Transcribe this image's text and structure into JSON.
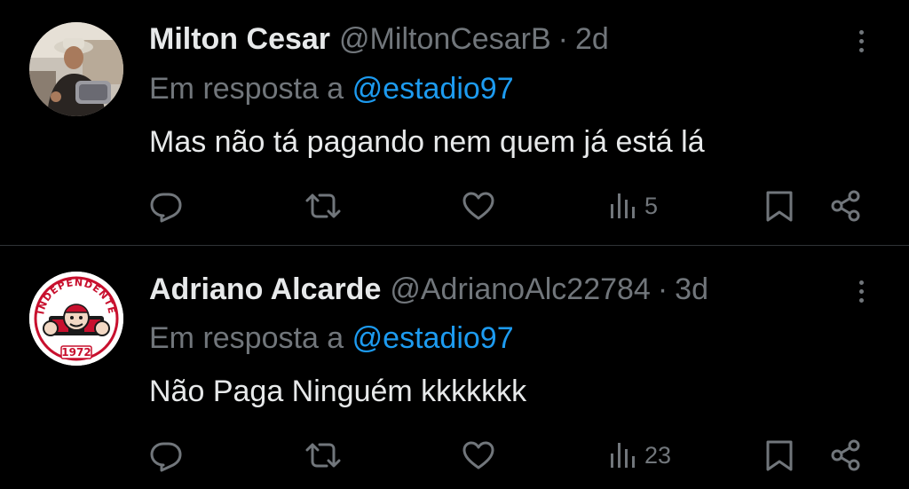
{
  "theme": {
    "background": "#000000",
    "text": "#e7e9ea",
    "muted": "#71767b",
    "link": "#1d9bf0",
    "divider": "#2f3336"
  },
  "tweets": [
    {
      "name": "Milton Cesar",
      "handle": "@MiltonCesarB",
      "separator": "·",
      "time": "2d",
      "reply_prefix": "Em resposta a ",
      "reply_mention": "@estadio97",
      "text": "Mas não tá pagando nem quem já está lá",
      "views": "5",
      "icons": [
        "reply-icon",
        "retweet-icon",
        "like-icon",
        "views-icon",
        "bookmark-icon",
        "share-icon",
        "more-icon"
      ]
    },
    {
      "name": "Adriano Alcarde",
      "handle": "@AdrianoAlc22784",
      "separator": "·",
      "time": "3d",
      "reply_prefix": "Em resposta a ",
      "reply_mention": "@estadio97",
      "text": "Não Paga Ninguém kkkkkkk",
      "views": "23",
      "avatar_badge": {
        "top_text": "INDEPENDENTE",
        "bottom_text": "1972"
      },
      "icons": [
        "reply-icon",
        "retweet-icon",
        "like-icon",
        "views-icon",
        "bookmark-icon",
        "share-icon",
        "more-icon"
      ]
    }
  ]
}
